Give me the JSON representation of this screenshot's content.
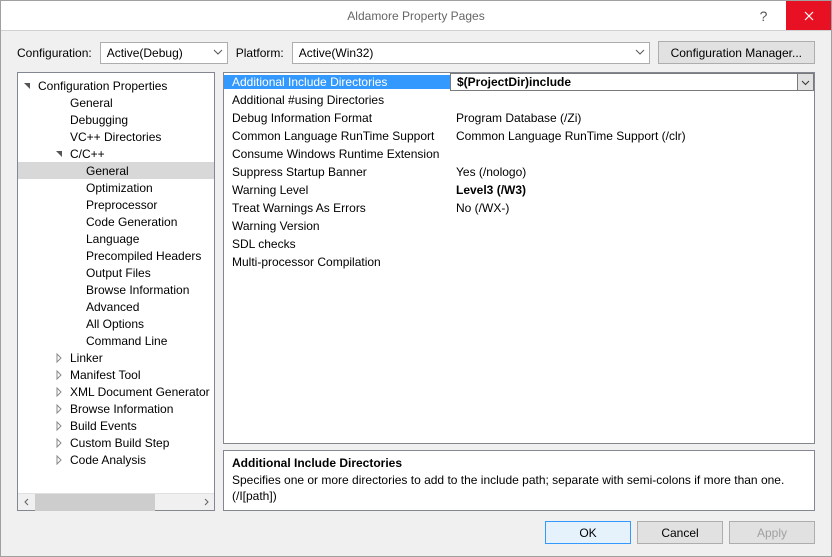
{
  "window": {
    "title": "Aldamore Property Pages"
  },
  "toolbar": {
    "config_label": "Configuration:",
    "config_value": "Active(Debug)",
    "platform_label": "Platform:",
    "platform_value": "Active(Win32)",
    "config_manager": "Configuration Manager..."
  },
  "tree": {
    "root": "Configuration Properties",
    "items": [
      {
        "label": "General",
        "indent": 2
      },
      {
        "label": "Debugging",
        "indent": 2
      },
      {
        "label": "VC++ Directories",
        "indent": 2
      },
      {
        "label": "C/C++",
        "indent": 2,
        "arrow": "open"
      },
      {
        "label": "General",
        "indent": 3,
        "selected": true
      },
      {
        "label": "Optimization",
        "indent": 3
      },
      {
        "label": "Preprocessor",
        "indent": 3
      },
      {
        "label": "Code Generation",
        "indent": 3
      },
      {
        "label": "Language",
        "indent": 3
      },
      {
        "label": "Precompiled Headers",
        "indent": 3
      },
      {
        "label": "Output Files",
        "indent": 3
      },
      {
        "label": "Browse Information",
        "indent": 3
      },
      {
        "label": "Advanced",
        "indent": 3
      },
      {
        "label": "All Options",
        "indent": 3
      },
      {
        "label": "Command Line",
        "indent": 3
      },
      {
        "label": "Linker",
        "indent": 2,
        "arrow": "closed"
      },
      {
        "label": "Manifest Tool",
        "indent": 2,
        "arrow": "closed"
      },
      {
        "label": "XML Document Generator",
        "indent": 2,
        "arrow": "closed"
      },
      {
        "label": "Browse Information",
        "indent": 2,
        "arrow": "closed"
      },
      {
        "label": "Build Events",
        "indent": 2,
        "arrow": "closed"
      },
      {
        "label": "Custom Build Step",
        "indent": 2,
        "arrow": "closed"
      },
      {
        "label": "Code Analysis",
        "indent": 2,
        "arrow": "closed"
      }
    ]
  },
  "grid": [
    {
      "name": "Additional Include Directories",
      "value": "$(ProjectDir)include",
      "selected": true,
      "bold": true
    },
    {
      "name": "Additional #using Directories",
      "value": ""
    },
    {
      "name": "Debug Information Format",
      "value": "Program Database (/Zi)"
    },
    {
      "name": "Common Language RunTime Support",
      "value": "Common Language RunTime Support (/clr)"
    },
    {
      "name": "Consume Windows Runtime Extension",
      "value": ""
    },
    {
      "name": "Suppress Startup Banner",
      "value": "Yes (/nologo)"
    },
    {
      "name": "Warning Level",
      "value": "Level3 (/W3)",
      "bold": true
    },
    {
      "name": "Treat Warnings As Errors",
      "value": "No (/WX-)"
    },
    {
      "name": "Warning Version",
      "value": ""
    },
    {
      "name": "SDL checks",
      "value": ""
    },
    {
      "name": "Multi-processor Compilation",
      "value": ""
    }
  ],
  "description": {
    "title": "Additional Include Directories",
    "body": "Specifies one or more directories to add to the include path; separate with semi-colons if more than one. (/I[path])"
  },
  "footer": {
    "ok": "OK",
    "cancel": "Cancel",
    "apply": "Apply"
  }
}
